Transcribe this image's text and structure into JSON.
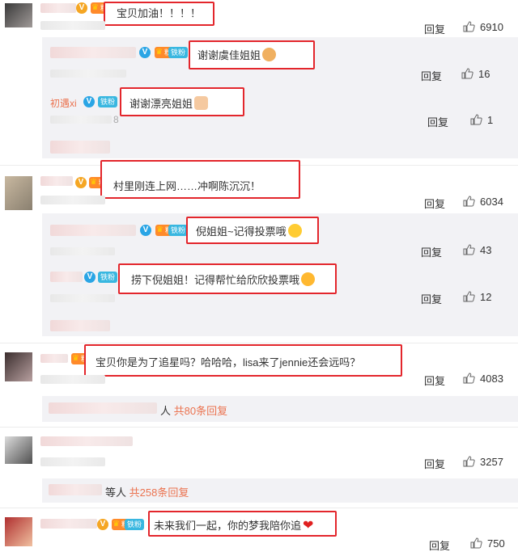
{
  "common": {
    "reply_label": "回复",
    "fan_badge": "粉",
    "iron_badge": "铁粉",
    "v_mark": "V"
  },
  "comments": [
    {
      "text": "宝贝加油！！！！",
      "likes": "6910"
    },
    {
      "text": "村里刚连上网……冲啊陈沉沉！",
      "likes": "6034"
    },
    {
      "text": "宝贝你是为了追星吗？哈哈哈，lisa来了jennie还会远吗？",
      "likes": "4083"
    },
    {
      "text": "",
      "likes": "3257"
    },
    {
      "text": "未来我们一起，你的梦我陪你追",
      "likes": "750"
    }
  ],
  "replies": [
    {
      "text": "谢谢虞佳姐姐",
      "likes": "16"
    },
    {
      "user": "初遇xi",
      "text": "谢谢漂亮姐姐",
      "time_suffix": "8",
      "likes": "1"
    },
    {
      "text": "倪姐姐~记得投票哦",
      "likes": "43"
    },
    {
      "text": "捞下倪姐姐！记得帮忙给欣欣投票哦",
      "likes": "12"
    }
  ],
  "more_replies": [
    {
      "prefix": "人",
      "count": "共80条回复"
    },
    {
      "prefix": "等人",
      "count": "共258条回复"
    }
  ],
  "colors": {
    "highlight_red": "#e3262c",
    "link_orange": "#eb7350",
    "verified_blue": "#2aa5e5",
    "iron_blue": "#39b7e0"
  }
}
